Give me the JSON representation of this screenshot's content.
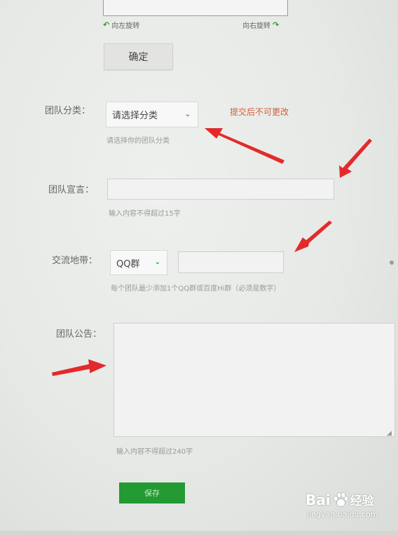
{
  "image_preview": {
    "rotate_left": "向左旋转",
    "rotate_right": "向右旋转"
  },
  "confirm_button": "确定",
  "form": {
    "category": {
      "label": "团队分类：",
      "selected": "请选择分类",
      "hint": "请选择你的团队分类",
      "warning": "提交后不可更改"
    },
    "slogan": {
      "label": "团队宣言：",
      "value": "",
      "hint": "输入内容不得超过15字"
    },
    "contact": {
      "label": "交流地带：",
      "selected": "QQ群",
      "value": "",
      "hint": "每个团队最少添加1个QQ群或百度Hi群（必须是数字）"
    },
    "notice": {
      "label": "团队公告：",
      "value": "",
      "hint": "输入内容不得超过240字"
    }
  },
  "save_button": "保存",
  "watermark": {
    "brand_left": "Bai",
    "brand_right": "经验",
    "url": "jingyan.baidu.com"
  },
  "colors": {
    "accent_green": "#239a32",
    "warning_orange": "#d0603a",
    "annotation_red": "#e32a2a"
  }
}
